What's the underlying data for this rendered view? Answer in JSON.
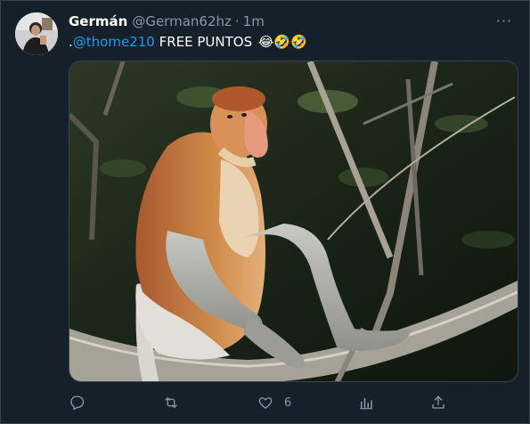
{
  "tweet": {
    "author_name": "Germán",
    "handle": "@German62hz",
    "separator": "·",
    "time": "1m",
    "text_prefix": ".",
    "mention": "@thome210",
    "text_body": " FREE PUNTOS ",
    "emojis": "😂🤣🤣",
    "more_label": "···"
  },
  "actions": {
    "reply_icon": "reply-icon",
    "retweet_icon": "retweet-icon",
    "like_icon": "heart-icon",
    "like_count": "6",
    "analytics_icon": "analytics-icon",
    "share_icon": "share-icon"
  },
  "colors": {
    "background": "#15202b",
    "border": "#38444d",
    "secondary_text": "#8899a6",
    "mention": "#1d9bf0"
  }
}
